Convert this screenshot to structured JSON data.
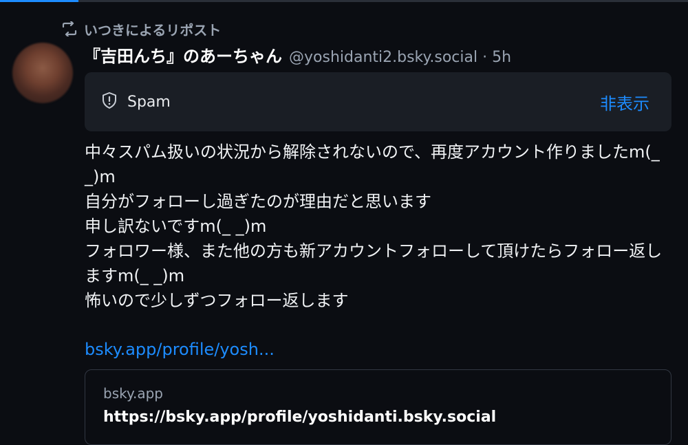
{
  "repost": {
    "icon": "repost-icon",
    "label": "いつきによるリポスト"
  },
  "post": {
    "display_name": "『吉田んち』のあーちゃん",
    "handle_meta": "@yoshidanti2.bsky.social · 5h",
    "spam_label": "Spam",
    "spam_icon": "shield-icon",
    "hide_label": "非表示",
    "body": "中々スパム扱いの状況から解除されないので、再度アカウント作りましたm(_ _)m\n自分がフォローし過ぎたのが理由だと思います\n申し訳ないですm(_ _)m\nフォロワー様、また他の方も新アカウントフォローして頂けたらフォロー返しますm(_ _)m\n怖いので少しずつフォロー返します",
    "link": "bsky.app/profile/yosh...",
    "embed": {
      "domain": "bsky.app",
      "url": "https://bsky.app/profile/yoshidanti.bsky.social"
    }
  },
  "colors": {
    "background": "#0b0d12",
    "accent": "#1d8cff",
    "muted": "#9aa4b2",
    "card": "#1a1e25"
  }
}
